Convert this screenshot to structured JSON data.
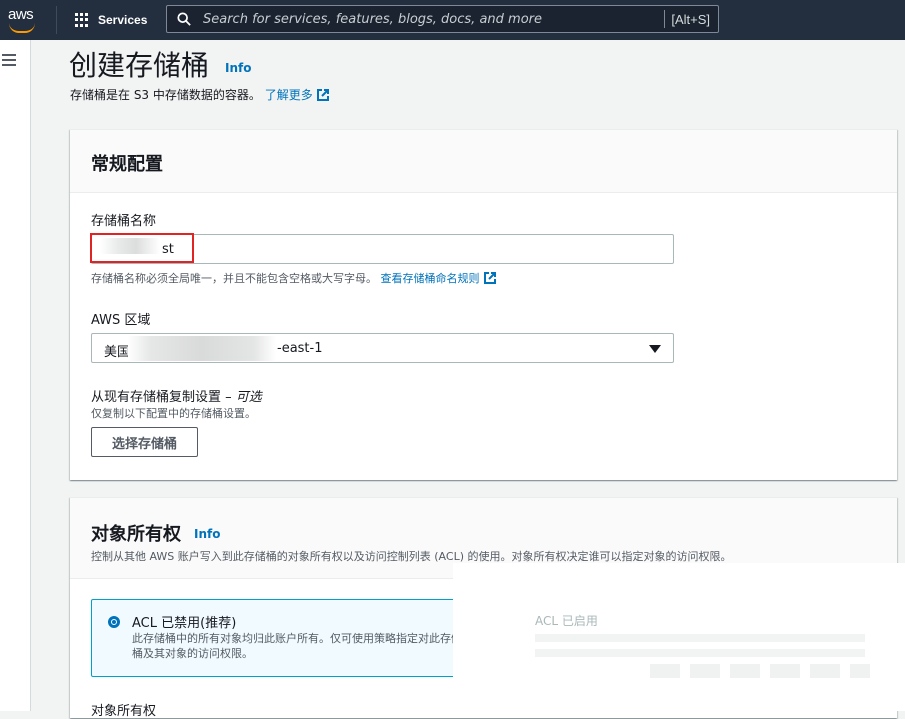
{
  "nav": {
    "logo": "aws",
    "services_label": "Services",
    "search_placeholder": "Search for services, features, blogs, docs, and more",
    "search_shortcut": "[Alt+S]"
  },
  "header": {
    "title": "创建存储桶",
    "info": "Info",
    "subtitle": "存储桶是在 S3 中存储数据的容器。",
    "learn_more": "了解更多"
  },
  "general": {
    "heading": "常规配置",
    "bucket_name_label": "存储桶名称",
    "bucket_name_value": "st",
    "bucket_name_hint": "存储桶名称必须全局唯一，并且不能包含空格或大写字母。",
    "naming_rules_link": "查看存储桶命名规则",
    "region_label": "AWS 区域",
    "region_prefix": "美国",
    "region_suffix": "-east-1",
    "copy_label": "从现有存储桶复制设置 –",
    "copy_optional": "可选",
    "copy_desc": "仅复制以下配置中的存储桶设置。",
    "choose_bucket_button": "选择存储桶"
  },
  "ownership": {
    "heading": "对象所有权",
    "info": "Info",
    "description": "控制从其他 AWS 账户写入到此存储桶的对象所有权以及访问控制列表 (ACL) 的使用。对象所有权决定谁可以指定对象的访问权限。",
    "acl_disabled_title": "ACL 已禁用(推荐)",
    "acl_disabled_desc": "此存储桶中的所有对象均归此账户所有。仅可使用策略指定对此存储桶及其对象的访问权限。",
    "acl_enabled_title": "ACL 已启用",
    "field_label": "对象所有权"
  },
  "colors": {
    "nav_bg": "#232f3e",
    "link": "#0073bb",
    "selected_border": "#00a1c9",
    "highlight": "#e02424",
    "aws_orange": "#ff9900"
  }
}
